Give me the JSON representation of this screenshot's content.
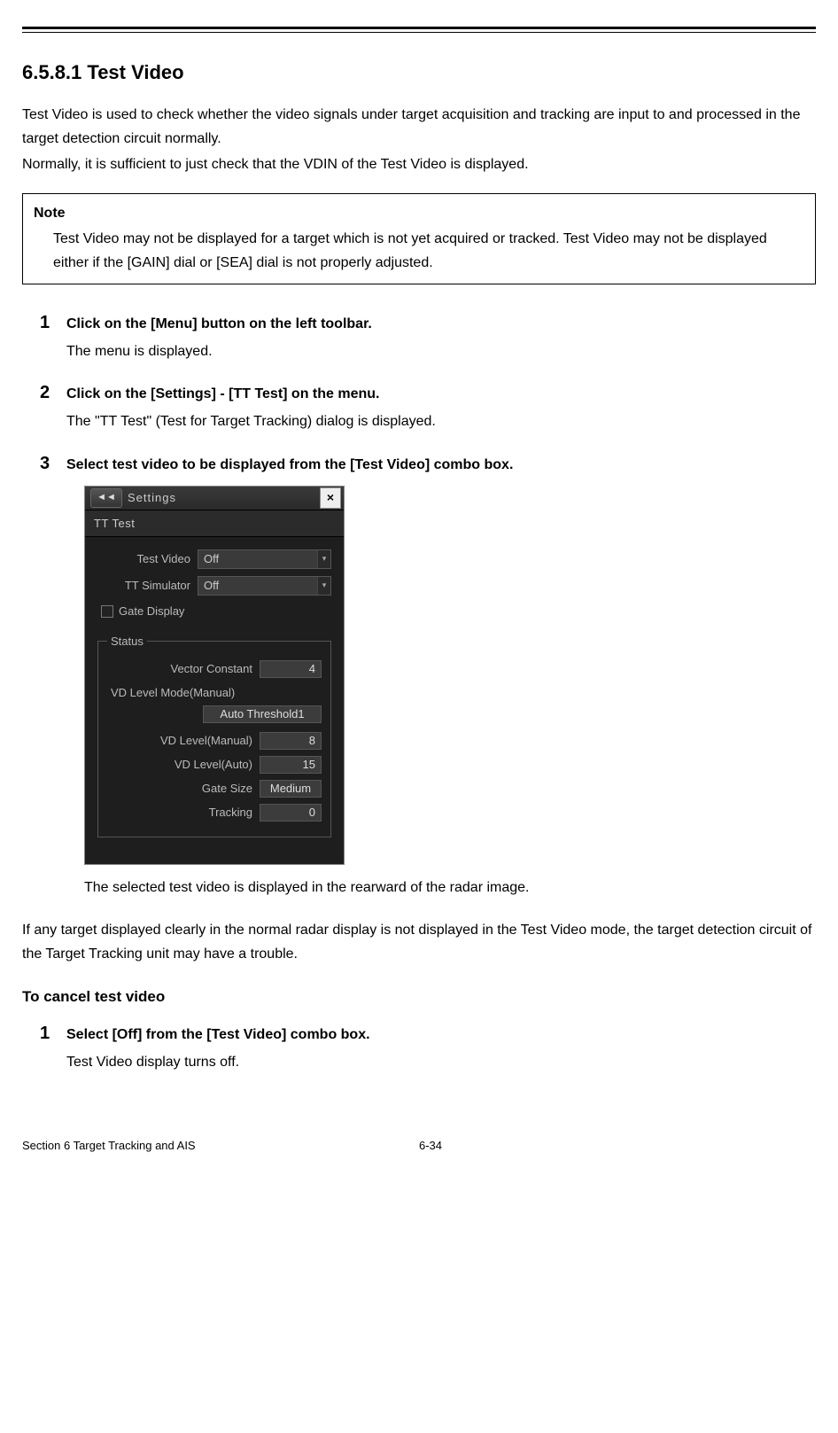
{
  "heading": "6.5.8.1    Test Video",
  "intro": {
    "p1": "Test Video is used to check whether the video signals under target acquisition and tracking are input to and processed in the target detection circuit normally.",
    "p2": "Normally, it is sufficient to just check that the VDIN of the Test Video is displayed."
  },
  "note": {
    "title": "Note",
    "body": "Test Video may not be displayed for a target which is not yet acquired or tracked. Test Video may not be displayed either if the [GAIN] dial or [SEA] dial is not properly adjusted."
  },
  "steps": [
    {
      "num": "1",
      "title": "Click on the [Menu] button on the left toolbar.",
      "body": "The menu is displayed."
    },
    {
      "num": "2",
      "title": "Click on the [Settings] - [TT Test] on the menu.",
      "body": "The \"TT Test\" (Test for Target Tracking) dialog is displayed."
    },
    {
      "num": "3",
      "title": "Select test video to be displayed from the [Test Video] combo box.",
      "body": ""
    }
  ],
  "dialog": {
    "back_glyph": "◄◄",
    "title": "Settings",
    "close_glyph": "×",
    "subtitle": "TT Test",
    "fields": {
      "test_video_label": "Test Video",
      "test_video_value": "Off",
      "tt_sim_label": "TT Simulator",
      "tt_sim_value": "Off",
      "gate_display_label": "Gate Display"
    },
    "status": {
      "legend": "Status",
      "vector_constant_label": "Vector Constant",
      "vector_constant_value": "4",
      "vd_level_mode_label": "VD Level Mode(Manual)",
      "vd_level_mode_value": "Auto Threshold1",
      "vd_level_manual_label": "VD Level(Manual)",
      "vd_level_manual_value": "8",
      "vd_level_auto_label": "VD Level(Auto)",
      "vd_level_auto_value": "15",
      "gate_size_label": "Gate Size",
      "gate_size_value": "Medium",
      "tracking_label": "Tracking",
      "tracking_value": "0"
    }
  },
  "after_dialog": "The selected test video is displayed in the rearward of the radar image.",
  "trouble_para": "If any target displayed clearly in the normal radar display is not displayed in the Test Video mode, the target detection circuit of the Target Tracking unit may have a trouble.",
  "cancel_heading": "To cancel test video",
  "cancel_steps": [
    {
      "num": "1",
      "title": "Select [Off] from the [Test Video] combo box.",
      "body": "Test Video display turns off."
    }
  ],
  "footer": {
    "left": "Section 6    Target Tracking and AIS",
    "center": "6-34"
  }
}
